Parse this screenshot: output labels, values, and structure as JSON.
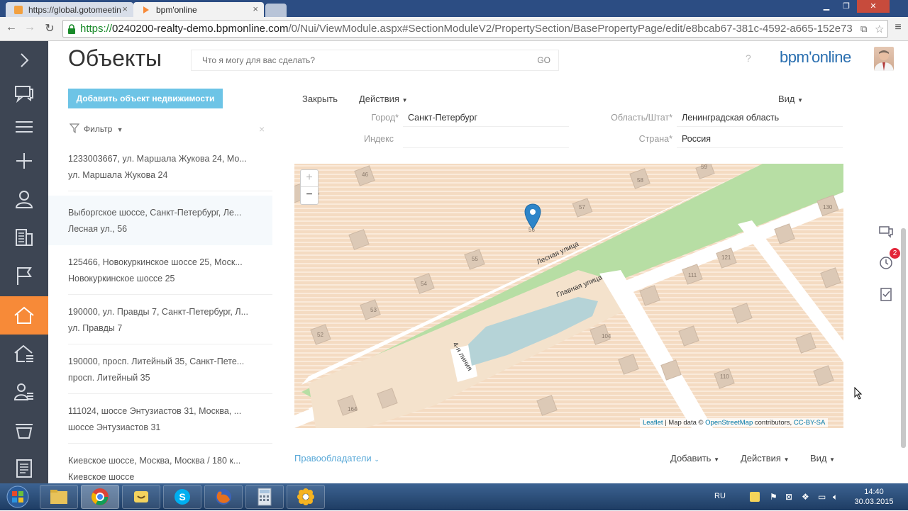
{
  "browser": {
    "tabs": [
      {
        "title": "https://global.gotomeetin"
      },
      {
        "title": "bpm'online"
      }
    ],
    "url": {
      "scheme": "https://",
      "host": "0240200-realty-demo.bpmonline.com",
      "path": "/0/Nui/ViewModule.aspx#SectionModuleV2/PropertySection/BasePropertyPage/edit/e8bcab67-381c-4592-a665-152e73"
    }
  },
  "rail": {
    "items": [
      {
        "icon": "expand-chevron-icon"
      },
      {
        "icon": "chat-icon"
      },
      {
        "icon": "menu-icon"
      },
      {
        "icon": "plus-icon"
      },
      {
        "icon": "contact-icon"
      },
      {
        "icon": "accounts-icon"
      },
      {
        "icon": "flag-icon"
      },
      {
        "icon": "home-icon",
        "active": true
      },
      {
        "icon": "property-icon"
      },
      {
        "icon": "clients-icon"
      },
      {
        "icon": "funnel-icon"
      },
      {
        "icon": "document-icon"
      }
    ]
  },
  "header": {
    "section_title": "Объекты",
    "search_placeholder": "Что я могу для вас сделать?",
    "go_label": "GO",
    "help": "?",
    "logo": "bpm'online"
  },
  "section": {
    "add_button": "Добавить объект недвижимости",
    "filter_label": "Фильтр",
    "filter_close": "×",
    "list": [
      {
        "line1": "1233003667, ул. Маршала Жукова 24, Мо...",
        "line2": "ул. Маршала Жукова 24"
      },
      {
        "line1": "Выборгское шоссе, Санкт-Петербург, Ле...",
        "line2": "Лесная ул., 56",
        "selected": true
      },
      {
        "line1": "125466, Новокуркинское шоссе 25, Моск...",
        "line2": "Новокуркинское шоссе 25"
      },
      {
        "line1": "190000, ул. Правды 7, Санкт-Петербург, Л...",
        "line2": "ул. Правды 7"
      },
      {
        "line1": "190000, просп. Литейный 35, Санкт-Пете...",
        "line2": "просп. Литейный 35"
      },
      {
        "line1": "111024, шоссе Энтузиастов 31, Москва, ...",
        "line2": "шоссе Энтузиастов 31"
      },
      {
        "line1": "Киевское шоссе, Москва, Москва / 180 к...",
        "line2": "Киевское шоссе"
      }
    ]
  },
  "page": {
    "close": "Закрыть",
    "actions": "Действия",
    "view": "Вид",
    "fields": {
      "city_label": "Город*",
      "city_value": "Санкт-Петербург",
      "region_label": "Область/Штат*",
      "region_value": "Ленинградская область",
      "zip_label": "Индекс",
      "zip_value": "",
      "country_label": "Страна*",
      "country_value": "Россия"
    },
    "map": {
      "zoom_in": "+",
      "zoom_out": "−",
      "street1": "Лесная улица",
      "street2": "Главная улица",
      "street3": "4-я линия",
      "house_numbers": [
        "46",
        "58",
        "59",
        "57",
        "130",
        "56",
        "55",
        "121",
        "54",
        "111",
        "53",
        "52",
        "104",
        "110",
        "164",
        "5"
      ],
      "attrib_leaflet": "Leaflet",
      "attrib_mid": " | Map data © ",
      "attrib_osm": "OpenStreetMap",
      "attrib_contrib": " contributors, ",
      "attrib_license": "CC-BY-SA"
    },
    "owners_tab": "Правообладатели",
    "bottom": {
      "add": "Добавить",
      "actions": "Действия",
      "view": "Вид"
    }
  },
  "side_panel": {
    "notifications_badge": "2"
  },
  "taskbar": {
    "lang": "RU",
    "time": "14:40",
    "date": "30.03.2015"
  }
}
